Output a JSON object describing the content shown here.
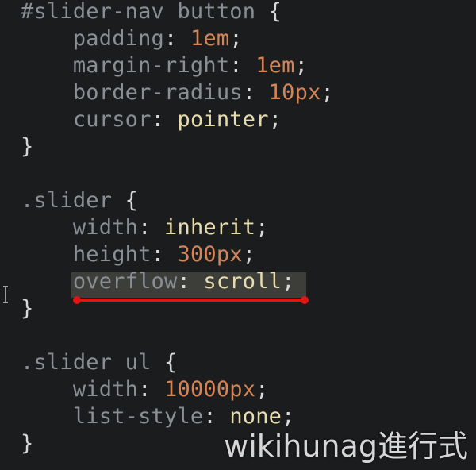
{
  "editor": {
    "lines": [
      {
        "tokens": [
          {
            "t": "#slider-nav button",
            "c": "sel"
          },
          {
            "t": " {",
            "c": "brace"
          }
        ]
      },
      {
        "tokens": [
          {
            "t": "    padding",
            "c": "prop"
          },
          {
            "t": ": ",
            "c": "colon"
          },
          {
            "t": "1em",
            "c": "num"
          },
          {
            "t": ";",
            "c": "semi"
          }
        ]
      },
      {
        "tokens": [
          {
            "t": "    margin-right",
            "c": "prop"
          },
          {
            "t": ": ",
            "c": "colon"
          },
          {
            "t": "1em",
            "c": "num"
          },
          {
            "t": ";",
            "c": "semi"
          }
        ]
      },
      {
        "tokens": [
          {
            "t": "    border-radius",
            "c": "prop"
          },
          {
            "t": ": ",
            "c": "colon"
          },
          {
            "t": "10px",
            "c": "num"
          },
          {
            "t": ";",
            "c": "semi"
          }
        ]
      },
      {
        "tokens": [
          {
            "t": "    cursor",
            "c": "prop"
          },
          {
            "t": ": ",
            "c": "colon"
          },
          {
            "t": "pointer",
            "c": "kw"
          },
          {
            "t": ";",
            "c": "semi"
          }
        ]
      },
      {
        "tokens": [
          {
            "t": "}",
            "c": "brace"
          }
        ]
      },
      {
        "tokens": []
      },
      {
        "tokens": [
          {
            "t": ".slider",
            "c": "sel"
          },
          {
            "t": " {",
            "c": "brace"
          }
        ]
      },
      {
        "tokens": [
          {
            "t": "    width",
            "c": "prop"
          },
          {
            "t": ": ",
            "c": "colon"
          },
          {
            "t": "inherit",
            "c": "kw"
          },
          {
            "t": ";",
            "c": "semi"
          }
        ]
      },
      {
        "tokens": [
          {
            "t": "    height",
            "c": "prop"
          },
          {
            "t": ": ",
            "c": "colon"
          },
          {
            "t": "300px",
            "c": "num"
          },
          {
            "t": ";",
            "c": "semi"
          }
        ]
      },
      {
        "tokens": [
          {
            "t": "    overflow",
            "c": "prop"
          },
          {
            "t": ": ",
            "c": "colon"
          },
          {
            "t": "scroll",
            "c": "kw"
          },
          {
            "t": ";",
            "c": "semi"
          }
        ]
      },
      {
        "tokens": [
          {
            "t": "}",
            "c": "brace"
          }
        ]
      },
      {
        "tokens": []
      },
      {
        "tokens": [
          {
            "t": ".slider ul",
            "c": "sel"
          },
          {
            "t": " {",
            "c": "brace"
          }
        ]
      },
      {
        "tokens": [
          {
            "t": "    width",
            "c": "prop"
          },
          {
            "t": ": ",
            "c": "colon"
          },
          {
            "t": "10000px",
            "c": "num"
          },
          {
            "t": ";",
            "c": "semi"
          }
        ]
      },
      {
        "tokens": [
          {
            "t": "    list-style",
            "c": "prop"
          },
          {
            "t": ": ",
            "c": "colon"
          },
          {
            "t": "none",
            "c": "kw"
          },
          {
            "t": ";",
            "c": "semi"
          }
        ]
      },
      {
        "tokens": [
          {
            "t": "}",
            "c": "brace"
          }
        ]
      }
    ],
    "highlighted_line": 10,
    "colors": {
      "background": "#1b1c1e",
      "selector": "#8a8f95",
      "property": "#8a8f95",
      "number": "#d38557",
      "keyword": "#e7dcae",
      "underline": "#e01515"
    }
  },
  "icons": {
    "text_cursor": "i-beam-cursor-icon"
  },
  "watermark": {
    "text": "wikihunag進行式"
  }
}
